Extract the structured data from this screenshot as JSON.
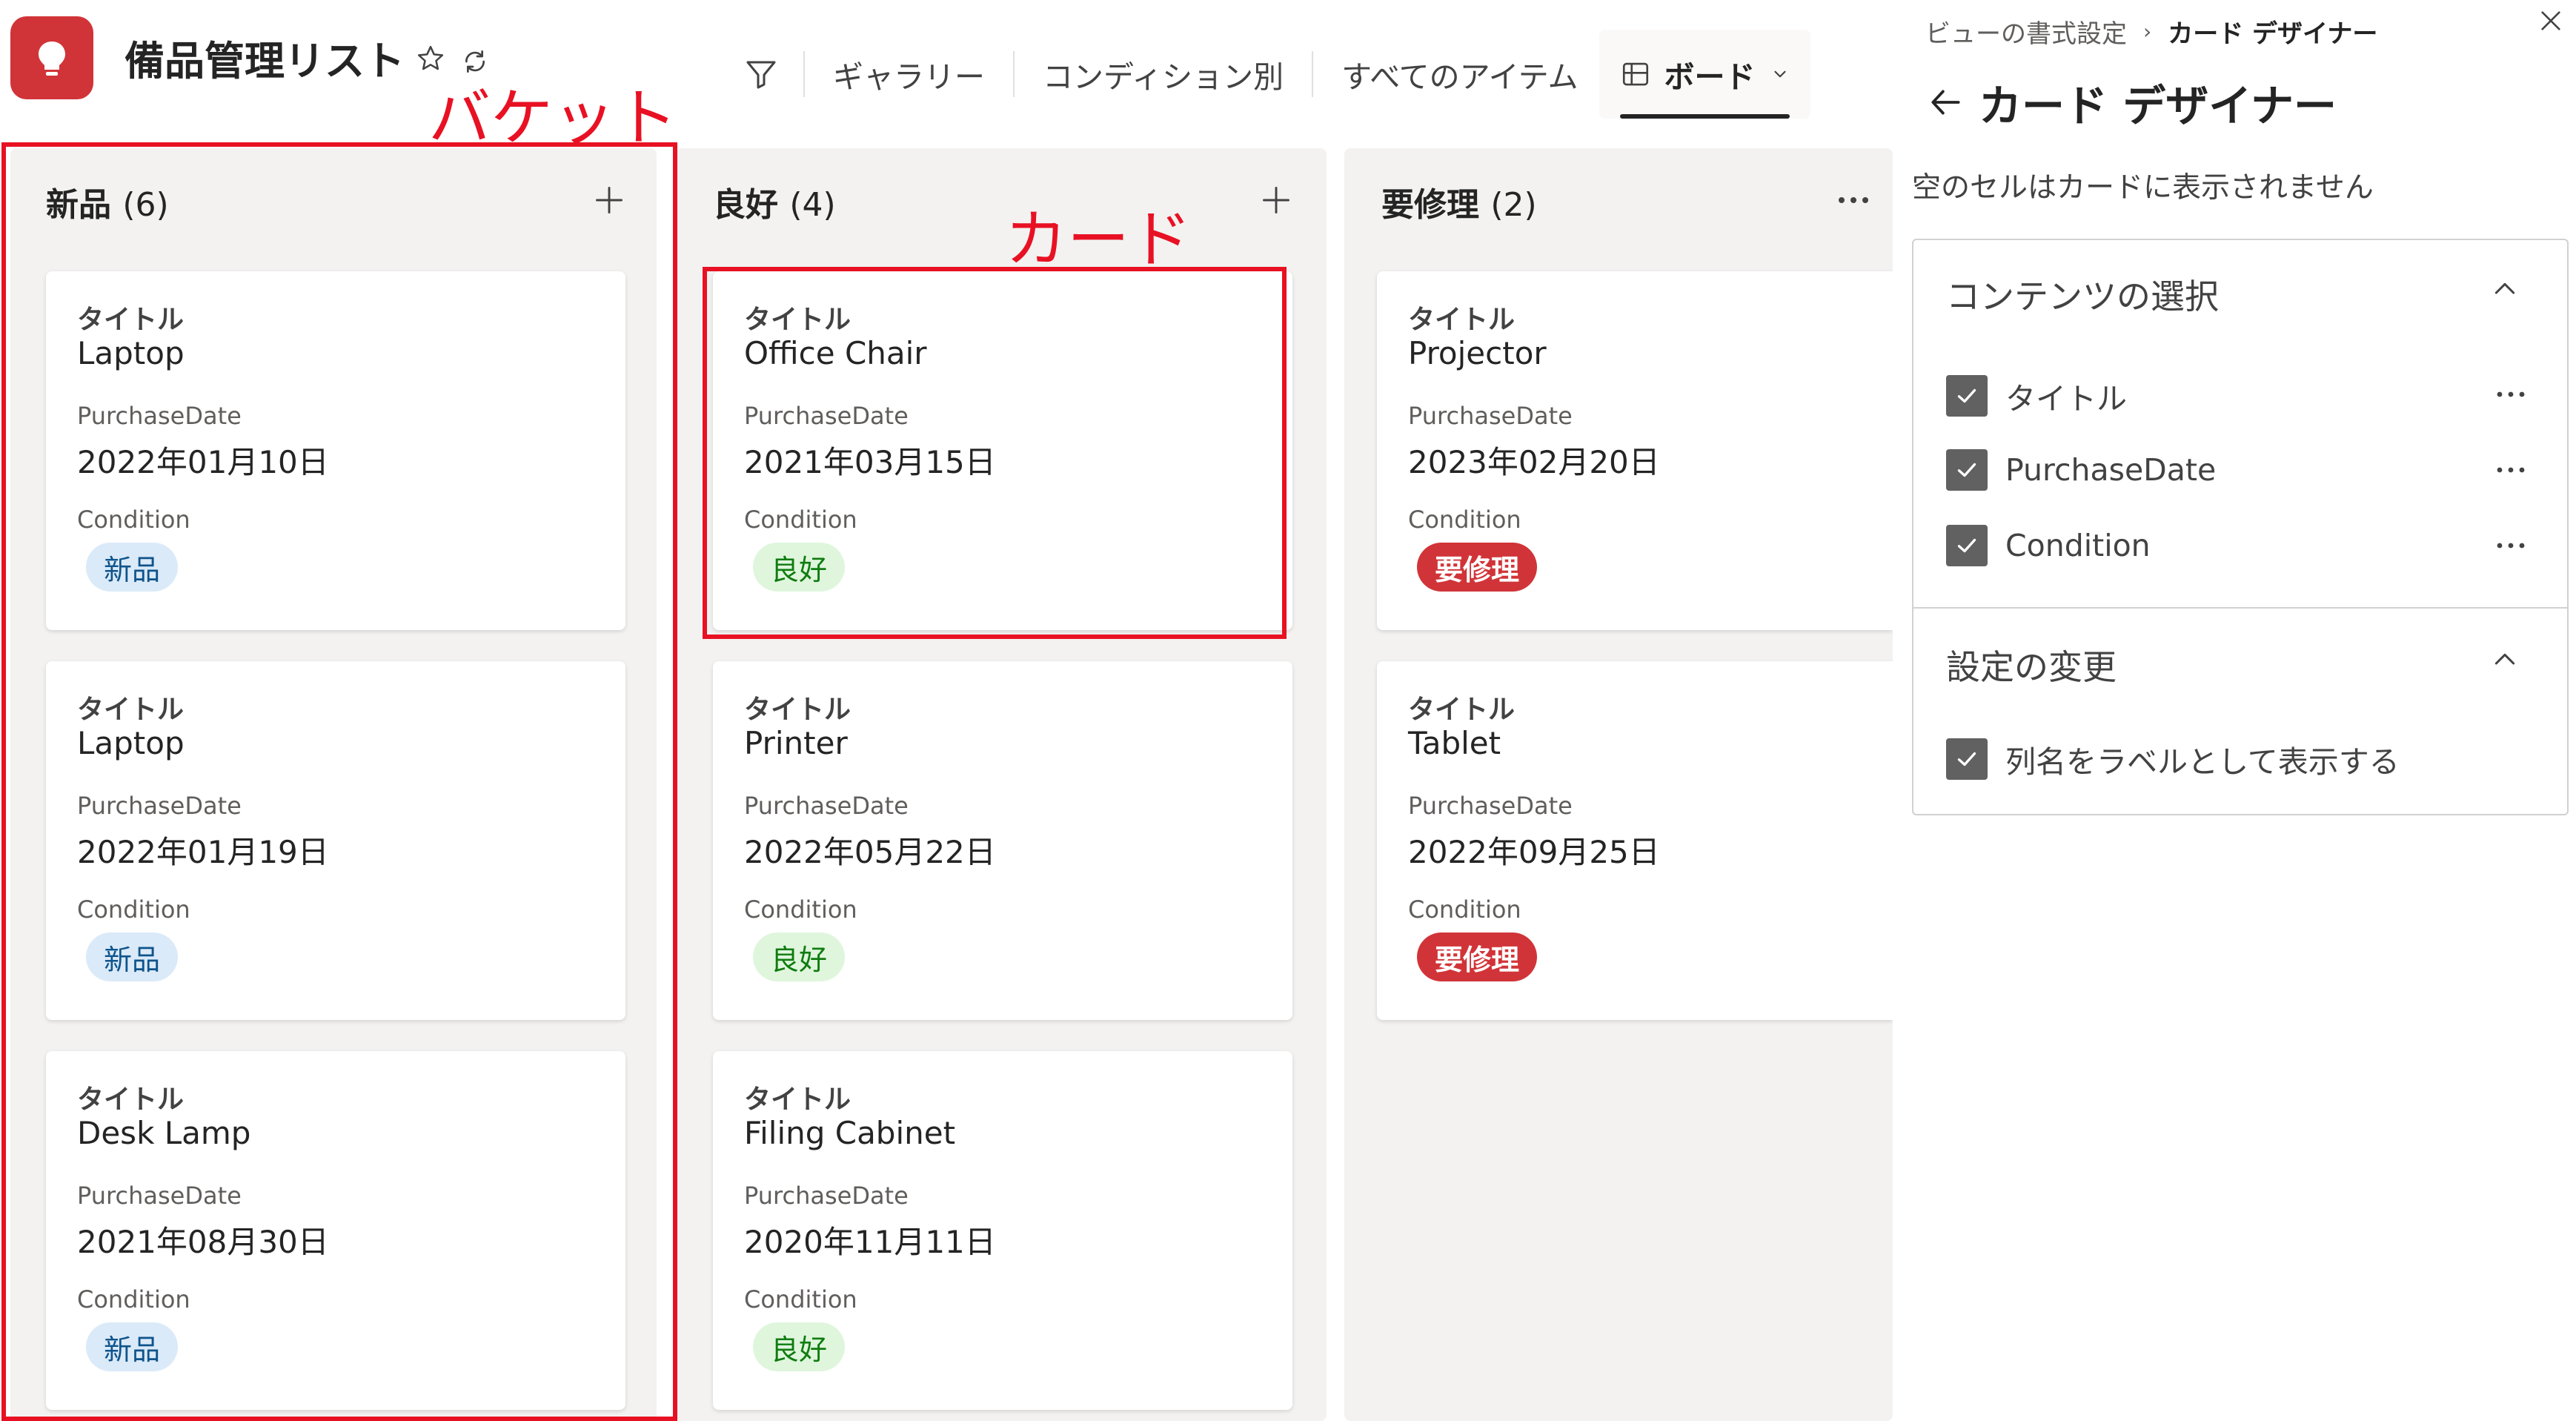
{
  "header": {
    "site_title": "備品管理リスト",
    "views": [
      "ギャラリー",
      "コンディション別",
      "すべてのアイテム"
    ],
    "active_view": "ボード"
  },
  "annotations": {
    "bucket_label": "バケット",
    "card_label": "カード"
  },
  "board": {
    "buckets": [
      {
        "name": "新品",
        "count": "(6)",
        "cards": [
          {
            "title_label": "タイトル",
            "title": "Laptop",
            "date_label": "PurchaseDate",
            "date": "2022年01月10日",
            "cond_label": "Condition",
            "condition": "新品"
          },
          {
            "title_label": "タイトル",
            "title": "Laptop",
            "date_label": "PurchaseDate",
            "date": "2022年01月19日",
            "cond_label": "Condition",
            "condition": "新品"
          },
          {
            "title_label": "タイトル",
            "title": "Desk Lamp",
            "date_label": "PurchaseDate",
            "date": "2021年08月30日",
            "cond_label": "Condition",
            "condition": "新品"
          }
        ]
      },
      {
        "name": "良好",
        "count": "(4)",
        "cards": [
          {
            "title_label": "タイトル",
            "title": "Office Chair",
            "date_label": "PurchaseDate",
            "date": "2021年03月15日",
            "cond_label": "Condition",
            "condition": "良好"
          },
          {
            "title_label": "タイトル",
            "title": "Printer",
            "date_label": "PurchaseDate",
            "date": "2022年05月22日",
            "cond_label": "Condition",
            "condition": "良好"
          },
          {
            "title_label": "タイトル",
            "title": "Filing Cabinet",
            "date_label": "PurchaseDate",
            "date": "2020年11月11日",
            "cond_label": "Condition",
            "condition": "良好"
          }
        ]
      },
      {
        "name": "要修理",
        "count": "(2)",
        "cards": [
          {
            "title_label": "タイトル",
            "title": "Projector",
            "date_label": "PurchaseDate",
            "date": "2023年02月20日",
            "cond_label": "Condition",
            "condition": "要修理"
          },
          {
            "title_label": "タイトル",
            "title": "Tablet",
            "date_label": "PurchaseDate",
            "date": "2022年09月25日",
            "cond_label": "Condition",
            "condition": "要修理"
          }
        ]
      }
    ]
  },
  "panel": {
    "breadcrumb_parent": "ビューの書式設定",
    "breadcrumb_current": "カード デザイナー",
    "title": "カード デザイナー",
    "description": "空のセルはカードに表示されません",
    "content_section": {
      "heading": "コンテンツの選択",
      "fields": [
        {
          "label": "タイトル",
          "checked": true
        },
        {
          "label": "PurchaseDate",
          "checked": true
        },
        {
          "label": "Condition",
          "checked": true
        }
      ]
    },
    "settings_section": {
      "heading": "設定の変更",
      "options": [
        {
          "label": "列名をラベルとして表示する",
          "checked": true
        }
      ]
    }
  },
  "colors": {
    "accent_red": "#d13438",
    "annotation_red": "#e81123",
    "pill_new_bg": "#dbeaf8",
    "pill_good_bg": "#dff6dd"
  }
}
